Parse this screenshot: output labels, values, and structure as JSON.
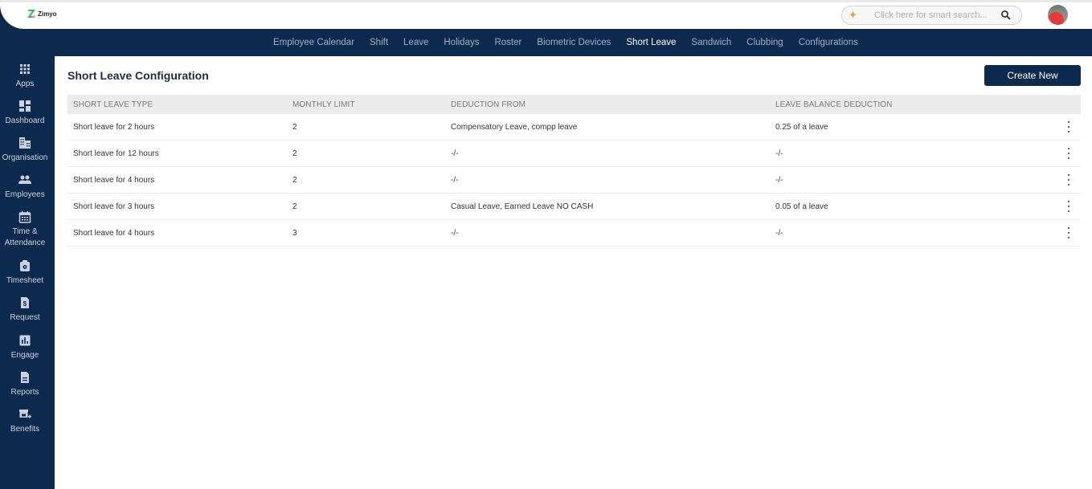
{
  "app": {
    "logo_text": "Zimyo"
  },
  "search": {
    "placeholder": "Click here for smart search...",
    "value": ""
  },
  "nav": {
    "tabs": [
      {
        "label": "Employee Calendar",
        "active": false
      },
      {
        "label": "Shift",
        "active": false
      },
      {
        "label": "Leave",
        "active": false
      },
      {
        "label": "Holidays",
        "active": false
      },
      {
        "label": "Roster",
        "active": false
      },
      {
        "label": "Biometric Devices",
        "active": false
      },
      {
        "label": "Short Leave",
        "active": true
      },
      {
        "label": "Sandwich",
        "active": false
      },
      {
        "label": "Clubbing",
        "active": false
      },
      {
        "label": "Configurations",
        "active": false
      }
    ]
  },
  "sidebar": {
    "items": [
      {
        "label": "Apps",
        "icon": "apps-grid-icon"
      },
      {
        "label": "Dashboard",
        "icon": "dashboard-icon"
      },
      {
        "label": "Organisation",
        "icon": "organisation-building-icon"
      },
      {
        "label": "Employees",
        "icon": "employees-people-icon"
      },
      {
        "label": "Time & Attendance",
        "icon": "calendar-icon"
      },
      {
        "label": "Timesheet",
        "icon": "timesheet-icon"
      },
      {
        "label": "Request",
        "icon": "request-dollar-doc-icon"
      },
      {
        "label": "Engage",
        "icon": "engage-chart-icon"
      },
      {
        "label": "Reports",
        "icon": "reports-doc-icon"
      },
      {
        "label": "Benefits",
        "icon": "benefits-store-icon"
      }
    ]
  },
  "main": {
    "title": "Short Leave Configuration",
    "create_button": "Create New",
    "table": {
      "columns": [
        "SHORT LEAVE TYPE",
        "MONTHLY LIMIT",
        "DEDUCTION FROM",
        "LEAVE BALANCE DEDUCTION"
      ],
      "rows": [
        {
          "type": "Short leave for 2 hours",
          "limit": "2",
          "deduction_from": "Compensatory Leave, compp leave",
          "balance_deduction": "0.25 of a leave"
        },
        {
          "type": "Short leave for 12 hours",
          "limit": "2",
          "deduction_from": "-/-",
          "balance_deduction": "-/-"
        },
        {
          "type": "Short leave for 4 hours",
          "limit": "2",
          "deduction_from": "-/-",
          "balance_deduction": "-/-"
        },
        {
          "type": "Short leave for 3 hours",
          "limit": "2",
          "deduction_from": "Casual Leave, Earned Leave NO CASH",
          "balance_deduction": "0.05 of a leave"
        },
        {
          "type": "Short leave for 4 hours",
          "limit": "3",
          "deduction_from": "-/-",
          "balance_deduction": "-/-"
        }
      ]
    }
  },
  "colors": {
    "brand_navy": "#0c2a4d",
    "nav_inactive": "#9fb0c4",
    "nav_active": "#ffffff",
    "table_header_bg": "#ececec"
  }
}
